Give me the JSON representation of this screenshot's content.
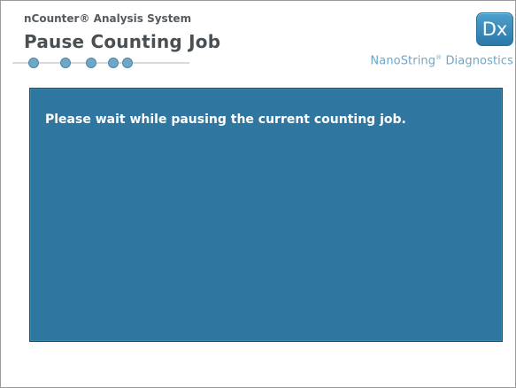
{
  "header": {
    "system_title": "nCounter® Analysis System",
    "page_title": "Pause Counting Job",
    "progress_steps": 5
  },
  "logo": {
    "dx_label": "Dx"
  },
  "brand": {
    "name": "NanoString",
    "reg_mark": "®",
    "suffix": " Diagnostics"
  },
  "message": {
    "text": "Please wait while pausing the current counting job."
  },
  "colors": {
    "panel": "#2f77a0",
    "accent": "#6aa8cc",
    "title": "#4a4f53"
  }
}
